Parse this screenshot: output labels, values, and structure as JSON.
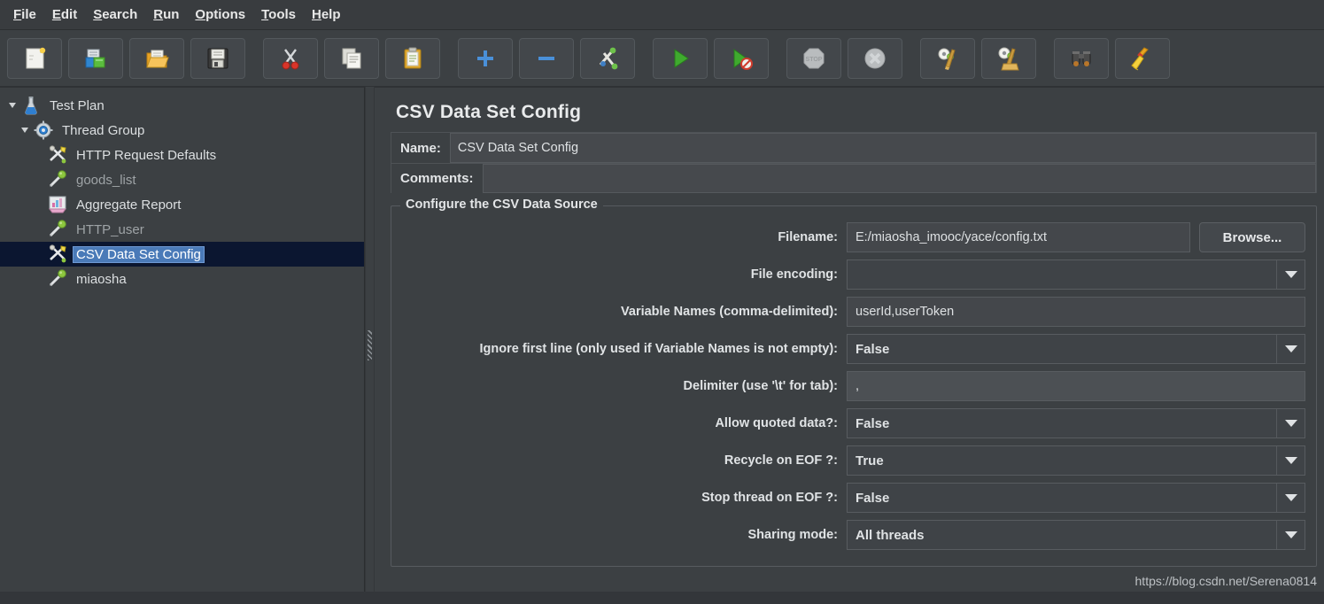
{
  "window": {
    "title": "CSV Data Set Config"
  },
  "menubar": {
    "items": [
      {
        "label": "File",
        "mnemonic": "F"
      },
      {
        "label": "Edit",
        "mnemonic": "E"
      },
      {
        "label": "Search",
        "mnemonic": "S"
      },
      {
        "label": "Run",
        "mnemonic": "R"
      },
      {
        "label": "Options",
        "mnemonic": "O"
      },
      {
        "label": "Tools",
        "mnemonic": "T"
      },
      {
        "label": "Help",
        "mnemonic": "H"
      }
    ]
  },
  "toolbar": {
    "buttons": [
      {
        "name": "new-icon",
        "tooltip": "New"
      },
      {
        "name": "templates-icon",
        "tooltip": "Templates"
      },
      {
        "name": "open-folder-icon",
        "tooltip": "Open"
      },
      {
        "name": "save-icon",
        "tooltip": "Save Test Plan"
      },
      {
        "name": "cut-icon",
        "tooltip": "Cut"
      },
      {
        "name": "copy-icon",
        "tooltip": "Copy"
      },
      {
        "name": "paste-icon",
        "tooltip": "Paste"
      },
      {
        "name": "expand-all-icon",
        "tooltip": "Expand All"
      },
      {
        "name": "collapse-all-icon",
        "tooltip": "Collapse All"
      },
      {
        "name": "toggle-icon",
        "tooltip": "Toggle"
      },
      {
        "name": "start-icon",
        "tooltip": "Start"
      },
      {
        "name": "start-no-pauses-icon",
        "tooltip": "Start no pauses"
      },
      {
        "name": "stop-icon",
        "tooltip": "Stop"
      },
      {
        "name": "shutdown-icon",
        "tooltip": "Shutdown"
      },
      {
        "name": "clear-icon",
        "tooltip": "Clear"
      },
      {
        "name": "clear-all-icon",
        "tooltip": "Clear All"
      },
      {
        "name": "search-icon",
        "tooltip": "Search"
      },
      {
        "name": "reset-search-icon",
        "tooltip": "Reset Search"
      }
    ]
  },
  "tree": {
    "nodes": [
      {
        "label": "Test Plan",
        "icon": "test-plan-icon",
        "depth": 0,
        "expanded": true,
        "selected": false,
        "dim": false
      },
      {
        "label": "Thread Group",
        "icon": "thread-group-icon",
        "depth": 1,
        "expanded": true,
        "selected": false,
        "dim": false
      },
      {
        "label": "HTTP Request Defaults",
        "icon": "config-element-icon",
        "depth": 2,
        "expanded": null,
        "selected": false,
        "dim": false
      },
      {
        "label": "goods_list",
        "icon": "http-sampler-icon",
        "depth": 2,
        "expanded": null,
        "selected": false,
        "dim": true
      },
      {
        "label": "Aggregate Report",
        "icon": "aggregate-report-icon",
        "depth": 2,
        "expanded": null,
        "selected": false,
        "dim": false
      },
      {
        "label": "HTTP_user",
        "icon": "http-sampler-icon",
        "depth": 2,
        "expanded": null,
        "selected": false,
        "dim": true
      },
      {
        "label": "CSV Data Set Config",
        "icon": "config-element-icon",
        "depth": 2,
        "expanded": null,
        "selected": true,
        "dim": false
      },
      {
        "label": "miaosha",
        "icon": "http-sampler-icon",
        "depth": 2,
        "expanded": null,
        "selected": false,
        "dim": false
      }
    ]
  },
  "editor": {
    "title": "CSV Data Set Config",
    "name_label": "Name:",
    "name_value": "CSV Data Set Config",
    "comments_label": "Comments:",
    "comments_value": "",
    "group_title": "Configure the CSV Data Source",
    "fields": [
      {
        "label": "Filename:",
        "type": "text-with-browse",
        "value": "E:/miaosha_imooc/yace/config.txt",
        "browse_label": "Browse...",
        "name": "filename"
      },
      {
        "label": "File encoding:",
        "type": "combo",
        "value": "",
        "name": "file-encoding"
      },
      {
        "label": "Variable Names (comma-delimited):",
        "type": "text",
        "value": "userId,userToken",
        "name": "variable-names"
      },
      {
        "label": "Ignore first line (only used if Variable Names is not empty):",
        "type": "combo",
        "value": "False",
        "name": "ignore-first-line"
      },
      {
        "label": "Delimiter (use '\\t' for tab):",
        "type": "text-light",
        "value": ",",
        "name": "delimiter"
      },
      {
        "label": "Allow quoted data?:",
        "type": "combo",
        "value": "False",
        "name": "allow-quoted-data"
      },
      {
        "label": "Recycle on EOF ?:",
        "type": "combo",
        "value": "True",
        "name": "recycle-on-eof"
      },
      {
        "label": "Stop thread on EOF ?:",
        "type": "combo",
        "value": "False",
        "name": "stop-thread-on-eof"
      },
      {
        "label": "Sharing mode:",
        "type": "combo",
        "value": "All threads",
        "name": "sharing-mode"
      }
    ]
  },
  "watermark": {
    "text": "https://blog.csdn.net/Serena0814"
  },
  "colors": {
    "background": "#3c4043",
    "panel": "#43474b",
    "text": "#e0e3e5",
    "text_dim": "#9ea3a6",
    "selection_band": "#0b1630",
    "selection_highlight": "#4a7ab8",
    "border": "#585c60",
    "accent_green": "#4caf50",
    "accent_blue": "#5b9bd5"
  }
}
